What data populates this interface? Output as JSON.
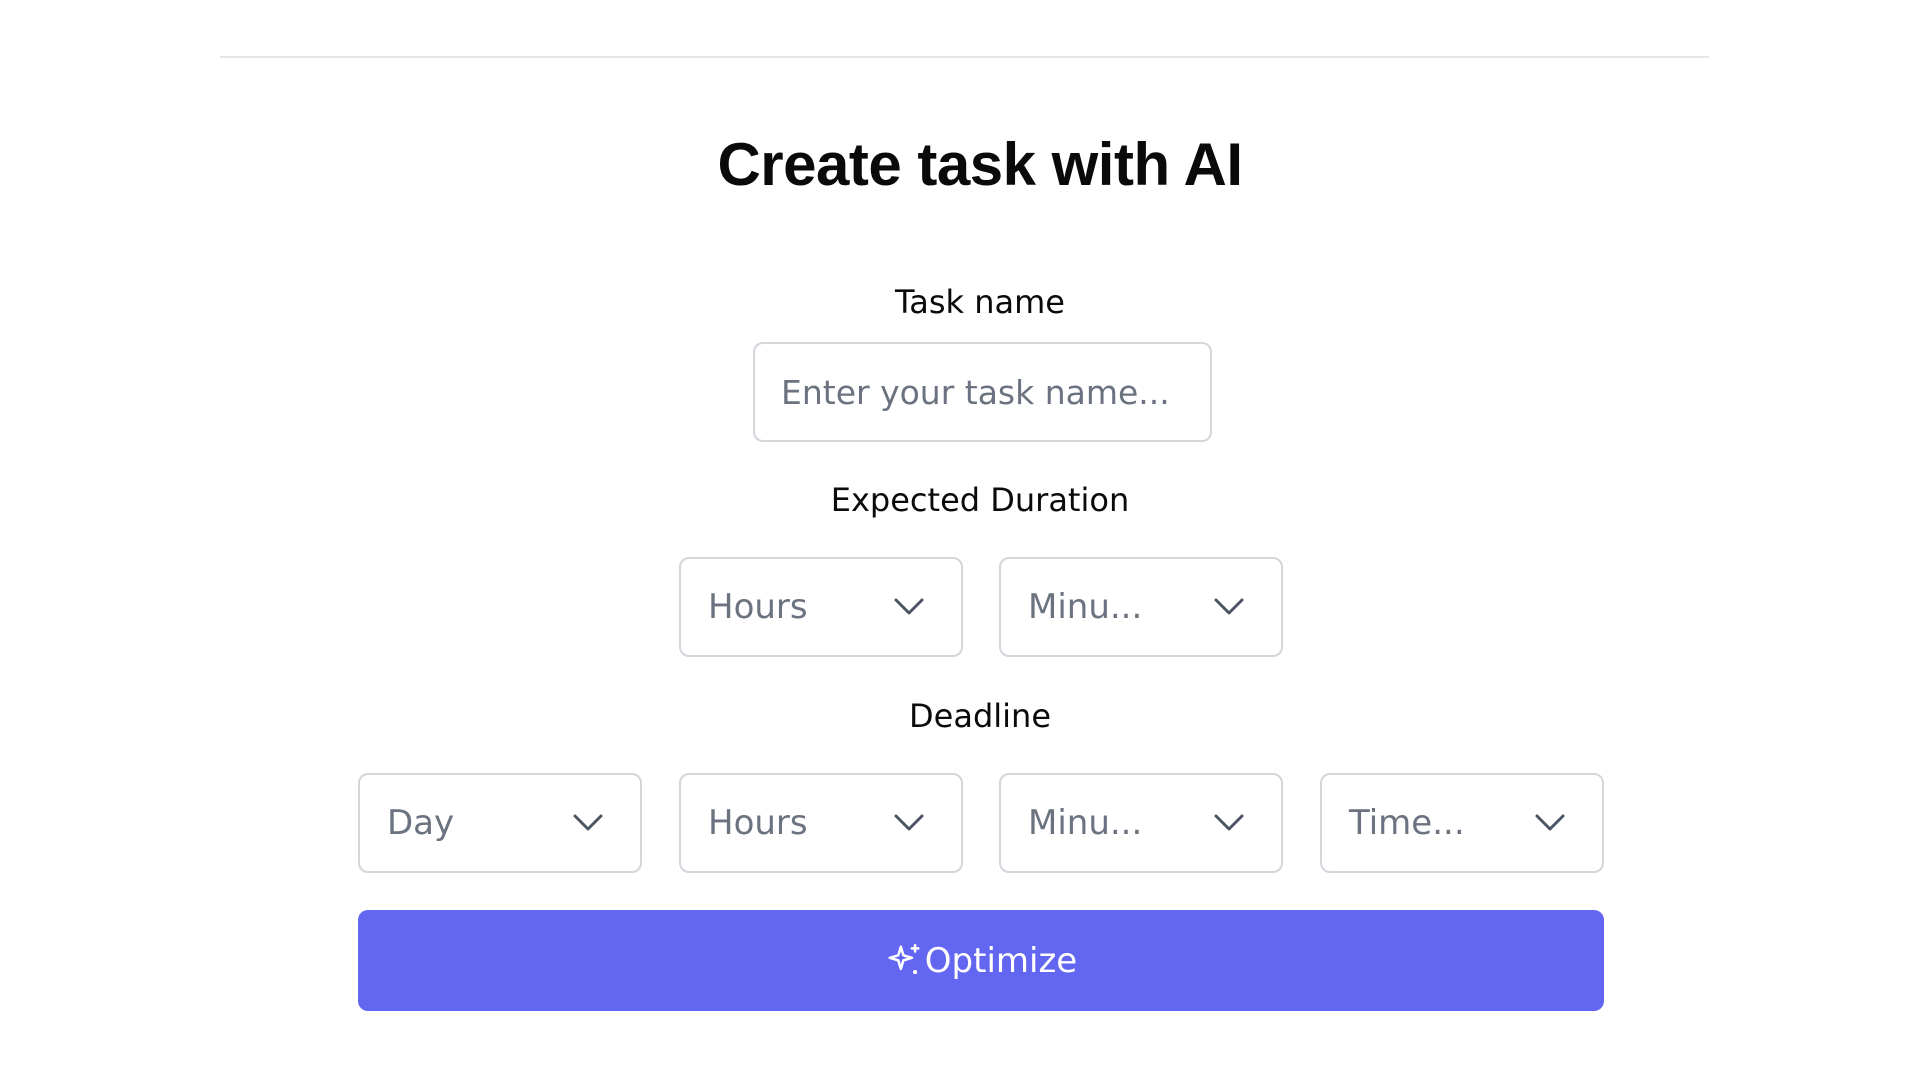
{
  "page": {
    "title": "Create task with AI"
  },
  "task": {
    "label": "Task name",
    "placeholder": "Enter your task name...",
    "value": ""
  },
  "duration": {
    "label": "Expected Duration",
    "hours_placeholder": "Hours",
    "minutes_placeholder": "Minu..."
  },
  "deadline": {
    "label": "Deadline",
    "day_placeholder": "Day",
    "hours_placeholder": "Hours",
    "minutes_placeholder": "Minu...",
    "time_placeholder": "Time..."
  },
  "actions": {
    "optimize_label": "Optimize",
    "optimize_icon": "sparkle-icon"
  },
  "colors": {
    "accent": "#6366f1",
    "placeholder": "#6b7280",
    "border": "#d4d6dc"
  }
}
